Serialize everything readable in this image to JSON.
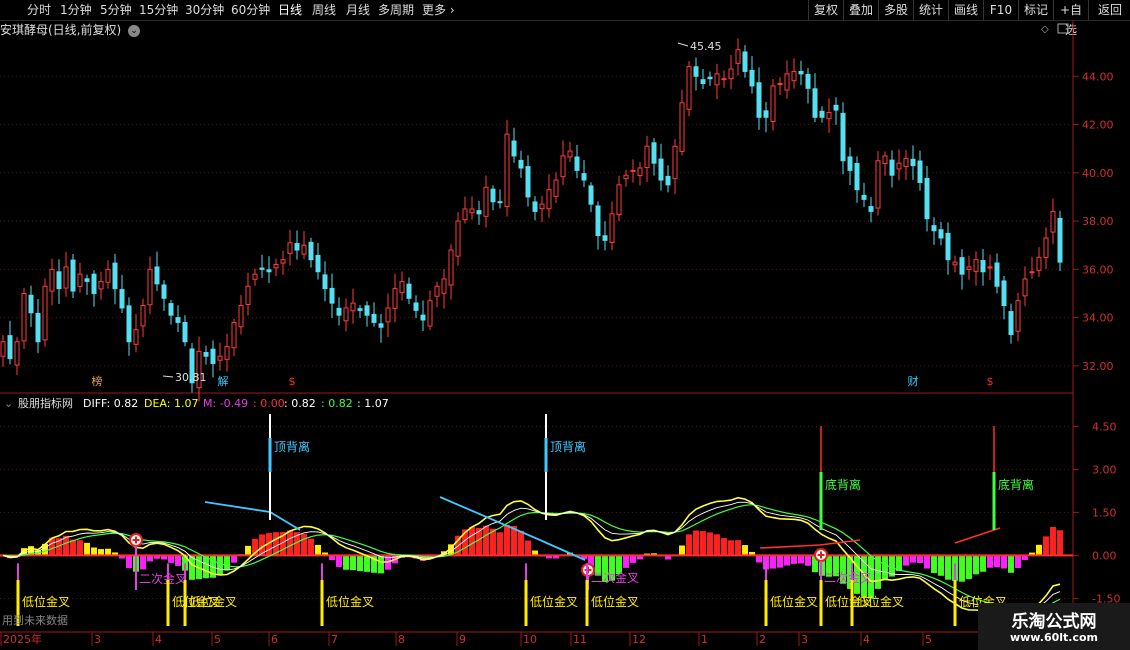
{
  "toolbar": {
    "periods": [
      "分时",
      "1分钟",
      "5分钟",
      "15分钟",
      "30分钟",
      "60分钟",
      "日线",
      "周线",
      "月线",
      "多周期",
      "更多"
    ],
    "active_period": "日线",
    "right_buttons": [
      "复权",
      "叠加",
      "多股",
      "统计",
      "画线",
      "F10",
      "标记",
      "+自选",
      "返回"
    ]
  },
  "stock": {
    "title": "安琪酵母(日线,前复权)"
  },
  "indicator": {
    "name": "股朋指标网",
    "diff_label": "DIFF: 0.82",
    "dea_label": "DEA: 1.07",
    "m_label": "M: -0.49",
    "v1": ": 0.00",
    "v2": ": 0.82",
    "v3": ": 0.82",
    "v4": ": 1.07"
  },
  "annotations": {
    "price_high": "45.45",
    "price_low": "30.81",
    "top_divergence": "顶背离",
    "bottom_divergence": "底背离",
    "golden_cross_low": "低位金叉",
    "second_golden_cross": "二次金叉",
    "future_data_note": "用到未来数据"
  },
  "markers": [
    {
      "text": "榜",
      "color": "#e6a23c"
    },
    {
      "text": "解",
      "color": "#40c8ff"
    },
    {
      "text": "$",
      "color": "#ff3030"
    },
    {
      "text": "财",
      "color": "#40c8ff"
    },
    {
      "text": "$",
      "color": "#ff3030"
    }
  ],
  "price_axis": [
    "44.00",
    "42.00",
    "40.00",
    "38.00",
    "36.00",
    "34.00",
    "32.00"
  ],
  "ind_axis": [
    "4.50",
    "3.00",
    "1.50",
    "0.00",
    "-1.50"
  ],
  "time_axis": [
    "2025年",
    "3",
    "4",
    "5",
    "6",
    "7",
    "8",
    "9",
    "10",
    "11",
    "12",
    "1",
    "2",
    "3",
    "4",
    "5"
  ],
  "watermark": {
    "title": "乐淘公式网",
    "url": "www.60lt.com"
  },
  "chart_data": {
    "type": "candlestick",
    "price_range": [
      30.81,
      45.45
    ],
    "ylim": [
      31,
      46
    ],
    "closes": [
      33,
      32.3,
      33,
      35,
      34.2,
      33,
      35.3,
      36,
      35.2,
      36.1,
      35.1,
      35.8,
      35.5,
      35,
      35.5,
      36,
      35.2,
      34.4,
      33,
      33.5,
      34.5,
      36,
      35.4,
      34.8,
      34.1,
      33.8,
      33,
      31.3,
      32.6,
      32.4,
      32.1,
      32.4,
      32.8,
      33.8,
      34.5,
      35.3,
      35.8,
      36,
      35.9,
      36.2,
      36.4,
      37.1,
      36.8,
      37,
      36.4,
      35.9,
      35.2,
      34.6,
      34.1,
      34.4,
      34.6,
      34.3,
      34.1,
      33.8,
      33.6,
      34.4,
      35.2,
      35.5,
      34.8,
      34.3,
      33.9,
      34.7,
      35.3,
      35.6,
      36.8,
      38,
      38.5,
      38.5,
      38.3,
      39.4,
      38.8,
      38.8,
      41.6,
      40.7,
      40.2,
      39,
      38.4,
      38.7,
      39.3,
      39.7,
      40.7,
      40.9,
      40.1,
      39.7,
      38.7,
      37.4,
      37.2,
      38.3,
      39.5,
      39.9,
      40.1,
      40.2,
      41.1,
      40.4,
      39.7,
      39.5,
      41.1,
      42.9,
      44.4,
      44,
      43.7,
      43.9,
      44.1,
      43.9,
      44.3,
      45.1,
      44.2,
      43.6,
      42.3,
      42.3,
      43.6,
      43.7,
      44.1,
      44.2,
      44.1,
      43.5,
      42.3,
      42.3,
      42.5,
      42.6,
      40.5,
      40.1,
      39.3,
      38.9,
      38.4,
      40.5,
      40.7,
      39.9,
      40.4,
      40.6,
      40.3,
      39.6,
      38.1,
      37.6,
      37.3,
      36.4,
      36.3,
      35.8,
      36.1,
      36.4,
      35.9,
      36.1,
      35.3,
      34.5,
      33.3,
      34.7,
      35.6,
      35.9,
      36.5,
      37.3,
      38.4,
      36.3
    ]
  }
}
